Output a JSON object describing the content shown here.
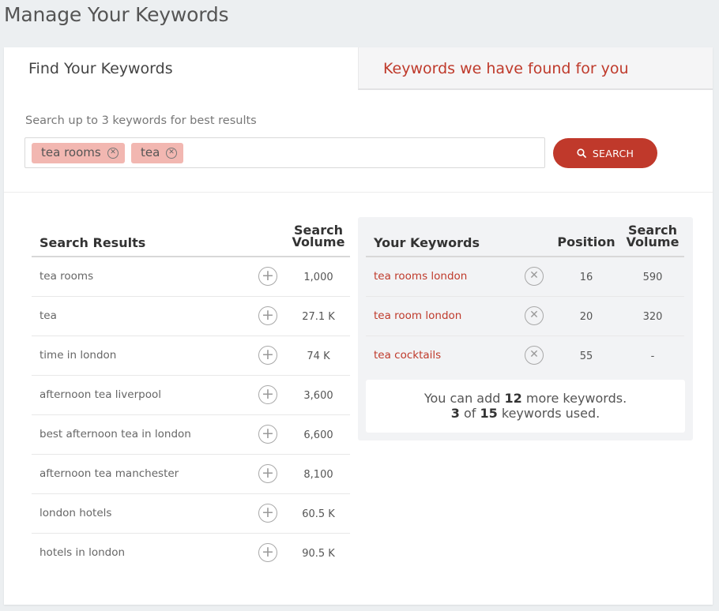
{
  "page": {
    "title": "Manage Your Keywords"
  },
  "tabs": [
    {
      "label": "Find Your Keywords",
      "active": true
    },
    {
      "label": "Keywords we have found for you",
      "active": false
    }
  ],
  "search": {
    "hint": "Search up to 3 keywords for best results",
    "chips": [
      "tea rooms",
      "tea"
    ],
    "button_label": "SEARCH",
    "button_icon": "search-icon"
  },
  "colors": {
    "accent": "#c0392b",
    "chip_bg": "#f2b7b1",
    "keyword_link": "#bf3a2b"
  },
  "results": {
    "heading": "Search Results",
    "volume_heading_line1": "Search",
    "volume_heading_line2": "Volume",
    "rows": [
      {
        "keyword": "tea rooms",
        "volume": "1,000"
      },
      {
        "keyword": "tea",
        "volume": "27.1 K"
      },
      {
        "keyword": "time in london",
        "volume": "74 K"
      },
      {
        "keyword": "afternoon tea liverpool",
        "volume": "3,600"
      },
      {
        "keyword": "best afternoon tea in london",
        "volume": "6,600"
      },
      {
        "keyword": "afternoon tea manchester",
        "volume": "8,100"
      },
      {
        "keyword": "london hotels",
        "volume": "60.5 K"
      },
      {
        "keyword": "hotels in london",
        "volume": "90.5 K"
      }
    ]
  },
  "your_keywords": {
    "heading": "Your Keywords",
    "position_heading": "Position",
    "volume_heading_line1": "Search",
    "volume_heading_line2": "Volume",
    "rows": [
      {
        "keyword": "tea rooms london",
        "position": "16",
        "volume": "590"
      },
      {
        "keyword": "tea room london",
        "position": "20",
        "volume": "320"
      },
      {
        "keyword": "tea cocktails",
        "position": "55",
        "volume": "-"
      }
    ],
    "notice": {
      "line1_prefix": "You can add",
      "remaining": "12",
      "line1_suffix": "more keywords.",
      "used": "3",
      "of": "of",
      "total": "15",
      "line2_suffix": "keywords used."
    }
  }
}
